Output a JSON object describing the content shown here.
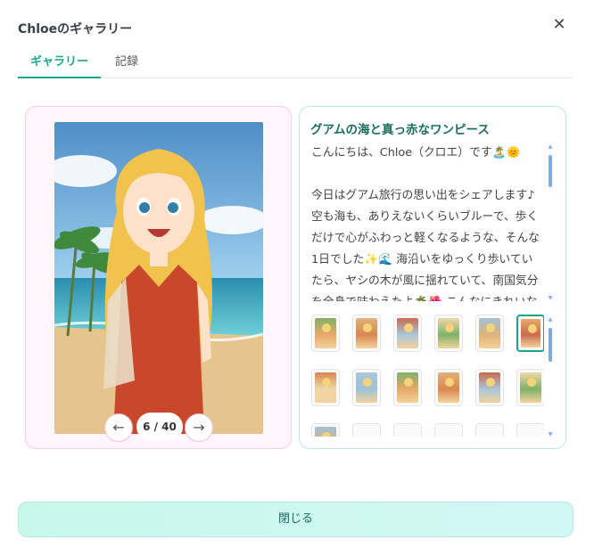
{
  "dialog": {
    "title": "Chloeのギャラリー",
    "close_icon": "close-icon"
  },
  "tabs": [
    {
      "label": "ギャラリー",
      "active": true
    },
    {
      "label": "記録",
      "active": false
    }
  ],
  "viewer": {
    "counter": "6 / 40",
    "prev_label": "←",
    "next_label": "→"
  },
  "post": {
    "title": "グアムの海と真っ赤なワンピース",
    "body": "こんにちは、Chloe（クロエ）です🏝️🌞\n\n今日はグアム旅行の思い出をシェアします♪ 空も海も、ありえないくらいブルーで、歩くだけで心がふわっと軽くなるような、そんな1日でした✨🌊 海沿いをゆっくり歩いていたら、ヤシの木が風に揺れていて、南国気分を全身で味わえたよ🌴🌺 こんなにきれいな海がすぐそばに"
  },
  "thumbnails": {
    "selected_index": 5,
    "palette": [
      "#e8a86a",
      "#d9874f",
      "#a9c7d9",
      "#7fb26a",
      "#e0b27a",
      "#c96b4d",
      "#f0d7a8",
      "#9ec2d8"
    ]
  },
  "footer": {
    "close_label": "閉じる"
  }
}
